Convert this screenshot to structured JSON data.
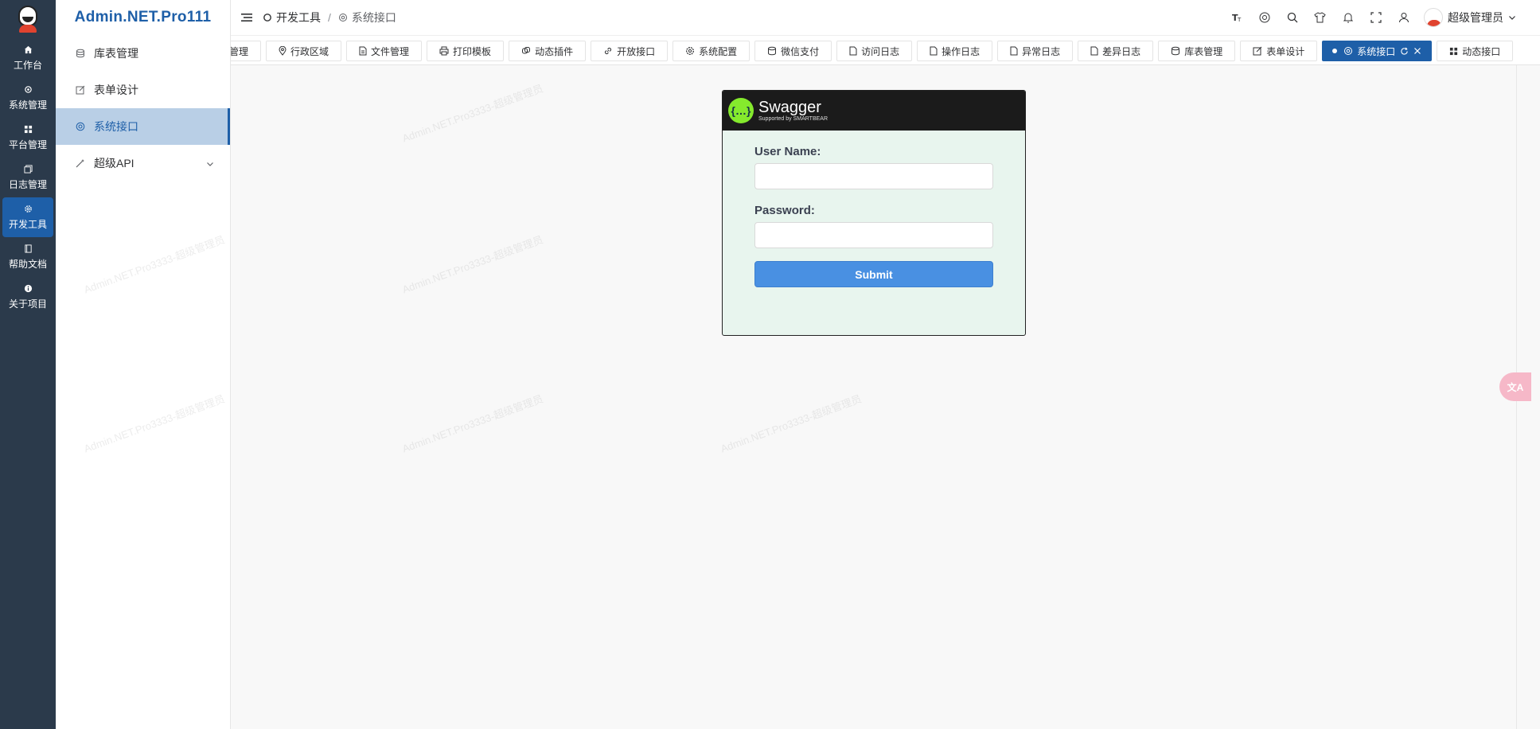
{
  "rail": {
    "items": [
      {
        "label": "工作台",
        "icon": "home-icon"
      },
      {
        "label": "系统管理",
        "icon": "gear-icon"
      },
      {
        "label": "平台管理",
        "icon": "grid-icon"
      },
      {
        "label": "日志管理",
        "icon": "copy-icon"
      },
      {
        "label": "开发工具",
        "icon": "cog-icon",
        "active": true
      },
      {
        "label": "帮助文档",
        "icon": "book-icon"
      },
      {
        "label": "关于项目",
        "icon": "info-icon"
      }
    ]
  },
  "sidebar": {
    "brand": "Admin.NET.Pro111",
    "items": [
      {
        "label": "库表管理",
        "icon": "database-icon"
      },
      {
        "label": "表单设计",
        "icon": "edit-icon"
      },
      {
        "label": "系统接口",
        "icon": "at-icon",
        "active": true
      },
      {
        "label": "超级API",
        "icon": "magic-icon"
      }
    ]
  },
  "header": {
    "breadcrumb": [
      "开发工具",
      "系统接口"
    ],
    "user_name": "超级管理员"
  },
  "tags": [
    {
      "label": "管理"
    },
    {
      "label": "行政区域",
      "icon": "location-icon"
    },
    {
      "label": "文件管理",
      "icon": "document-icon"
    },
    {
      "label": "打印模板",
      "icon": "printer-icon"
    },
    {
      "label": "动态插件",
      "icon": "plugin-icon"
    },
    {
      "label": "开放接口",
      "icon": "link-icon"
    },
    {
      "label": "系统配置",
      "icon": "gear-icon"
    },
    {
      "label": "微信支付",
      "icon": "database-icon"
    },
    {
      "label": "访问日志",
      "icon": "document-icon"
    },
    {
      "label": "操作日志",
      "icon": "document-icon"
    },
    {
      "label": "异常日志",
      "icon": "document-icon"
    },
    {
      "label": "差异日志",
      "icon": "document-icon"
    },
    {
      "label": "库表管理",
      "icon": "database-icon"
    },
    {
      "label": "表单设计",
      "icon": "edit-icon"
    },
    {
      "label": "系统接口",
      "icon": "at-icon",
      "active": true
    },
    {
      "label": "动态接口",
      "icon": "grid-icon"
    }
  ],
  "swagger": {
    "title": "Swagger",
    "subtitle": "Supported by SMARTBEAR",
    "username_label": "User Name:",
    "username_value": "",
    "password_label": "Password:",
    "password_value": "",
    "submit_label": "Submit"
  },
  "watermark_text": "Admin.NET.Pro3333-超级管理员",
  "translate_label": "文A"
}
